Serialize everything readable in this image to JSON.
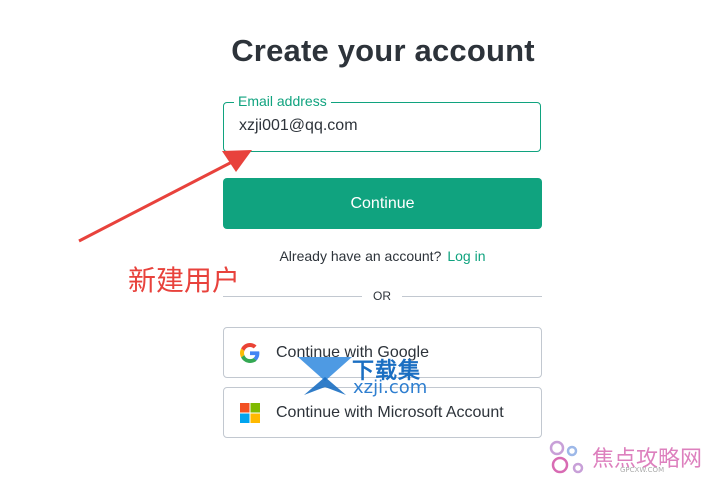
{
  "page": {
    "title": "Create your account"
  },
  "email": {
    "label": "Email address",
    "value": "xzji001@qq.com"
  },
  "continue_button": {
    "label": "Continue"
  },
  "login_prompt": {
    "text": "Already have an account?",
    "link": "Log in"
  },
  "divider": {
    "label": "OR"
  },
  "social": [
    {
      "label": "Continue with Google",
      "icon": "google-icon"
    },
    {
      "label": "Continue with Microsoft Account",
      "icon": "microsoft-icon"
    }
  ],
  "annotation": {
    "text": "新建用户",
    "color": "#e8423c"
  },
  "watermarks": [
    {
      "title": "下载集",
      "url": "xzji.com"
    },
    {
      "title": "焦点攻略网",
      "sub": "GPCXW.COM"
    }
  ],
  "colors": {
    "accent": "#10a37f",
    "text": "#2d333a",
    "border": "#c2c8d0"
  }
}
